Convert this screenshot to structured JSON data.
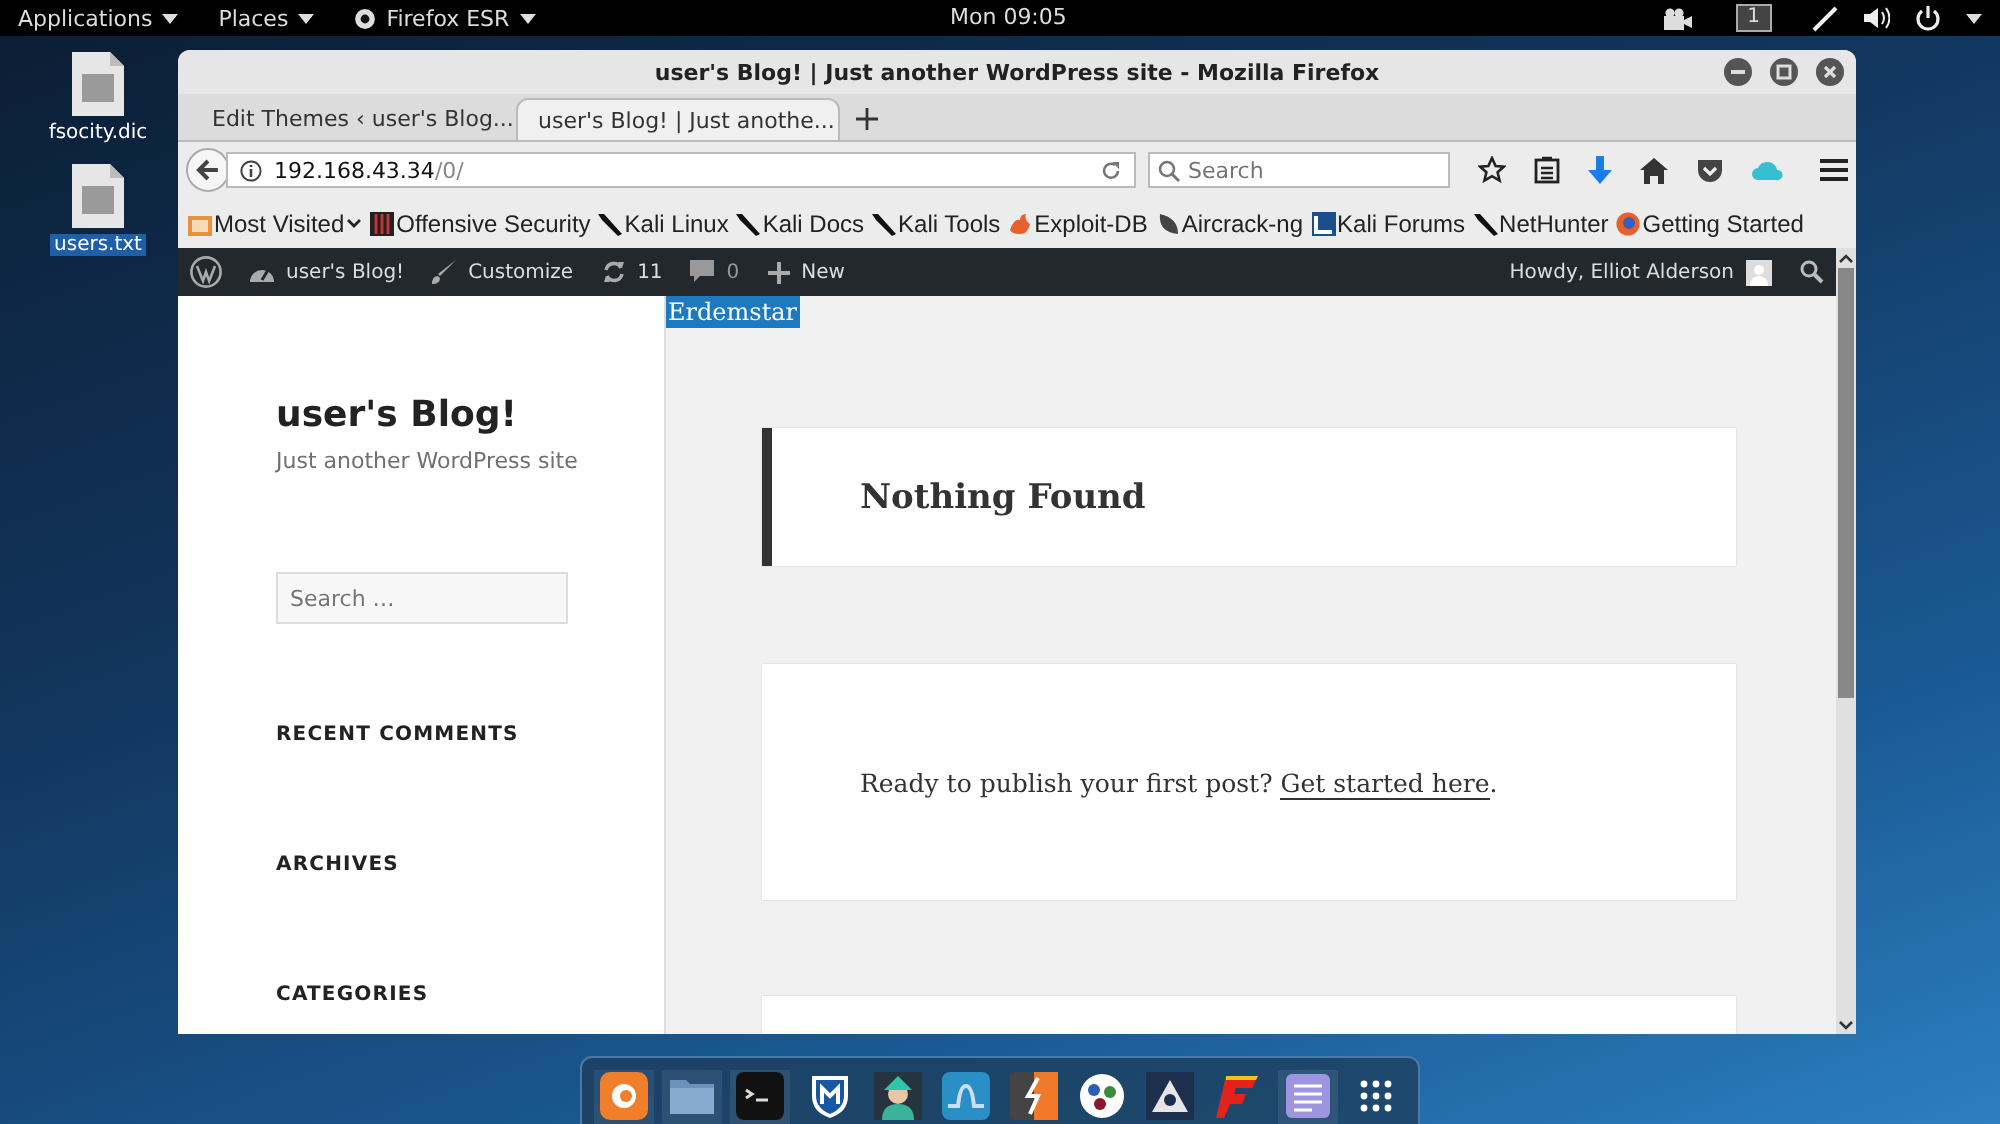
{
  "top_bar": {
    "menus": [
      {
        "label": "Applications"
      },
      {
        "label": "Places"
      },
      {
        "label": "Firefox ESR"
      }
    ],
    "clock": "Mon 09:05",
    "workspace": "1"
  },
  "desktop_icons": [
    {
      "label": "fsocity.dic",
      "selected": false
    },
    {
      "label": "users.txt",
      "selected": true
    }
  ],
  "window": {
    "title": "user's Blog! | Just another WordPress site - Mozilla Firefox",
    "tabs": [
      {
        "label": "Edit Themes ‹ user's Blog...",
        "selected": false
      },
      {
        "label": "user's Blog! | Just anothe...",
        "selected": true
      }
    ],
    "url": {
      "host": "192.168.43.34",
      "path": "/0/"
    },
    "search": {
      "placeholder": "Search"
    },
    "bookmarks": [
      {
        "label": "Most Visited"
      },
      {
        "label": "Offensive Security"
      },
      {
        "label": "Kali Linux"
      },
      {
        "label": "Kali Docs"
      },
      {
        "label": "Kali Tools"
      },
      {
        "label": "Exploit-DB"
      },
      {
        "label": "Aircrack-ng"
      },
      {
        "label": "Kali Forums"
      },
      {
        "label": "NetHunter"
      },
      {
        "label": "Getting Started"
      }
    ]
  },
  "admin_bar": {
    "site": "user's Blog!",
    "customize": "Customize",
    "updates": "11",
    "comments": "0",
    "new": "New",
    "howdy": "Howdy, Elliot Alderson"
  },
  "sidebar": {
    "title": "user's Blog!",
    "tagline": "Just another WordPress site",
    "search_placeholder": "Search …",
    "widgets": [
      "RECENT COMMENTS",
      "ARCHIVES",
      "CATEGORIES"
    ]
  },
  "main": {
    "highlight": "Erdemstar",
    "heading": "Nothing Found",
    "text_before": "Ready to publish your first post? ",
    "link": "Get started here",
    "text_after": "."
  },
  "dock": [
    {
      "running": true
    },
    {
      "running": true
    },
    {
      "running": true
    },
    {
      "running": false
    },
    {
      "running": false
    },
    {
      "running": false
    },
    {
      "running": false
    },
    {
      "running": false
    },
    {
      "running": false
    },
    {
      "running": false
    },
    {
      "running": true
    },
    {
      "running": false
    }
  ]
}
